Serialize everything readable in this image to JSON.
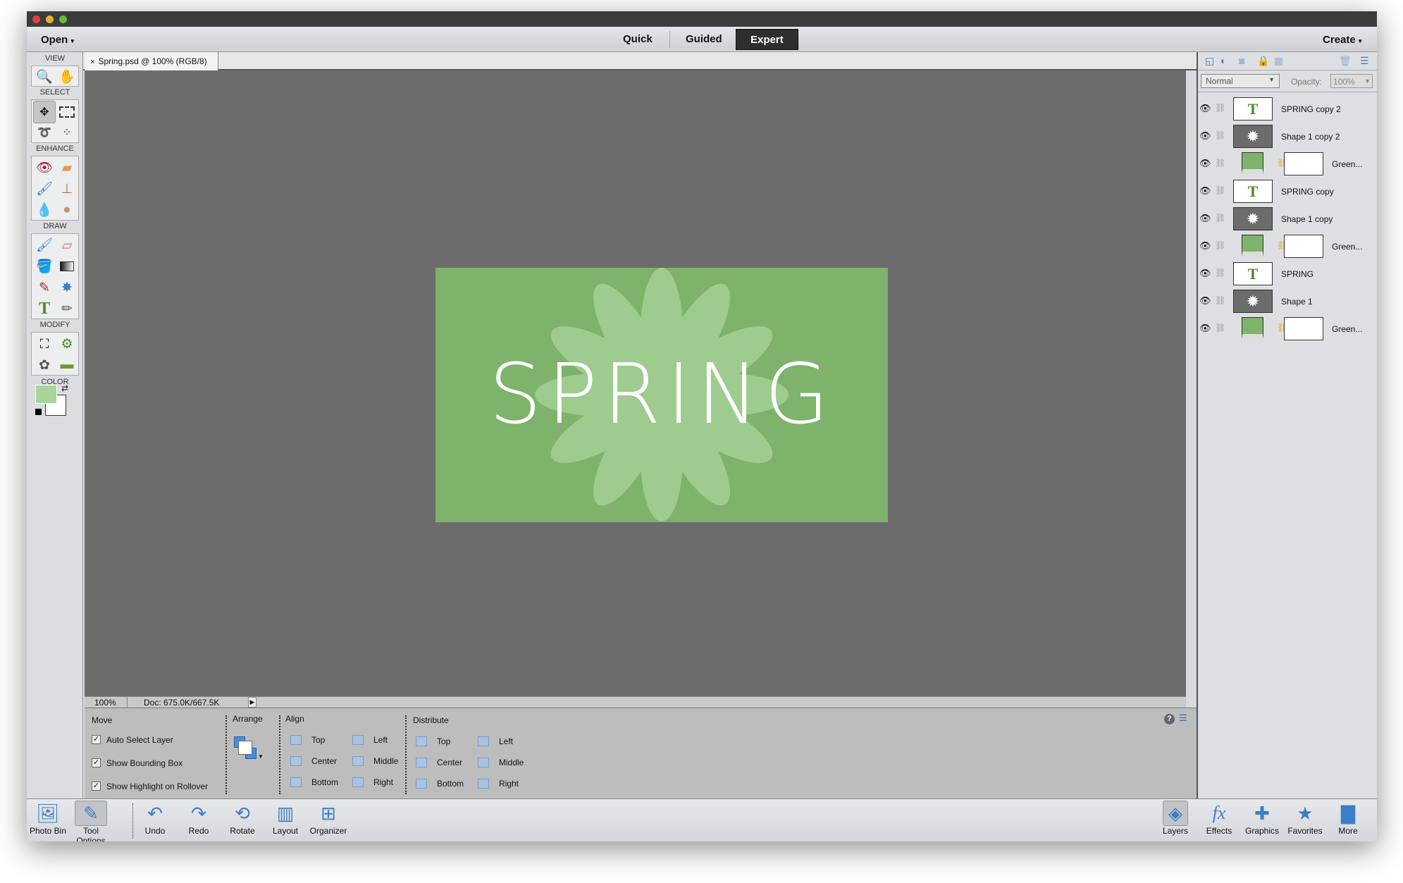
{
  "menubar": {
    "open": "Open",
    "modes": [
      "Quick",
      "Guided",
      "Expert"
    ],
    "active_mode": "Expert",
    "create": "Create"
  },
  "document_tab": {
    "title": "Spring.psd @ 100% (RGB/8)",
    "close": "×"
  },
  "toolbar": {
    "sections": [
      "VIEW",
      "SELECT",
      "ENHANCE",
      "DRAW",
      "MODIFY",
      "COLOR"
    ],
    "foreground_color": "#a8d49a",
    "background_color": "#ffffff"
  },
  "canvas": {
    "text": "SPRING",
    "background": "#7db36a"
  },
  "status": {
    "zoom": "100%",
    "doc": "Doc: 675.0K/667.5K"
  },
  "tool_options": {
    "move_title": "Move",
    "checkboxes": [
      {
        "label": "Auto Select Layer",
        "checked": true
      },
      {
        "label": "Show Bounding Box",
        "checked": true
      },
      {
        "label": "Show Highlight on Rollover",
        "checked": true
      }
    ],
    "arrange_title": "Arrange",
    "align_title": "Align",
    "align": [
      "Top",
      "Center",
      "Bottom",
      "Left",
      "Middle",
      "Right"
    ],
    "distribute_title": "Distribute",
    "distribute": [
      "Top",
      "Center",
      "Bottom",
      "Left",
      "Middle",
      "Right"
    ]
  },
  "layers_panel": {
    "blend_mode": "Normal",
    "opacity_label": "Opacity:",
    "opacity": "100%",
    "layers": [
      {
        "name": "SPRING copy 2",
        "type": "text"
      },
      {
        "name": "Shape 1 copy 2",
        "type": "shape"
      },
      {
        "name": "Green...",
        "type": "fill"
      },
      {
        "name": "SPRING copy",
        "type": "text"
      },
      {
        "name": "Shape 1 copy",
        "type": "shape"
      },
      {
        "name": "Green...",
        "type": "fill"
      },
      {
        "name": "SPRING",
        "type": "text"
      },
      {
        "name": "Shape 1",
        "type": "shape"
      },
      {
        "name": "Green...",
        "type": "fill"
      }
    ]
  },
  "taskbar": {
    "left": [
      "Photo Bin",
      "Tool Options",
      "Undo",
      "Redo",
      "Rotate",
      "Layout",
      "Organizer"
    ],
    "right": [
      "Layers",
      "Effects",
      "Graphics",
      "Favorites",
      "More"
    ]
  }
}
